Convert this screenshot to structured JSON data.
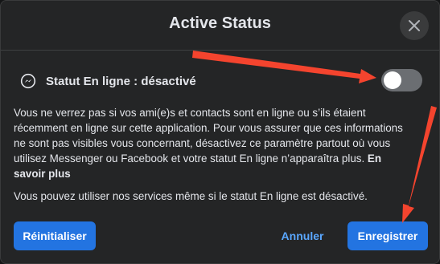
{
  "dialog": {
    "title": "Active Status",
    "close_icon": "close-icon"
  },
  "status": {
    "icon": "messenger-icon",
    "label": "Statut En ligne : désactivé",
    "toggle_on": false
  },
  "description": {
    "text": "Vous ne verrez pas si vos ami(e)s et contacts sont en ligne ou s’ils étaient récemment en ligne sur cette application. Pour vous assurer que ces informations ne sont pas visibles vous concernant, désactivez ce paramètre partout où vous utilisez Messenger ou Facebook et votre statut En ligne n’apparaîtra plus.",
    "link": "En savoir plus"
  },
  "note": "Vous pouvez utiliser nos services même si le statut En ligne est désactivé.",
  "buttons": {
    "reset": "Réinitialiser",
    "cancel": "Annuler",
    "save": "Enregistrer"
  },
  "colors": {
    "background": "#242526",
    "accent": "#2374e1",
    "link": "#5aa7ff",
    "arrow": "#f4442e",
    "toggle_off": "#6b6e72"
  }
}
